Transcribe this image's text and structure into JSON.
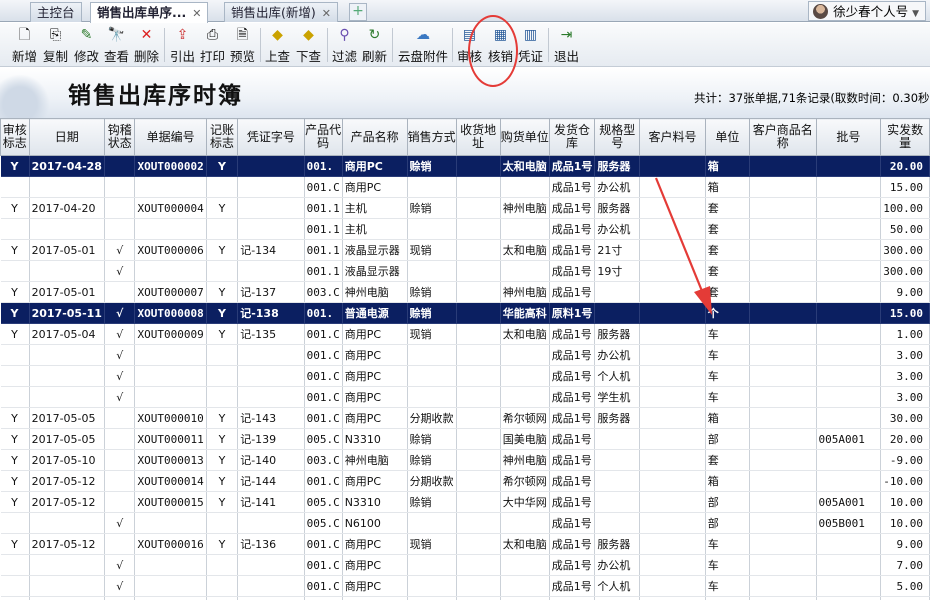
{
  "tabs": [
    {
      "label": "主控台",
      "active": false,
      "closable": false
    },
    {
      "label": "销售出库单序...",
      "active": true,
      "closable": true
    },
    {
      "label": "销售出库(新增)",
      "active": false,
      "closable": true
    }
  ],
  "user": {
    "name": "徐少春个人号"
  },
  "toolbar": {
    "new": "新增",
    "copy": "复制",
    "edit": "修改",
    "view": "查看",
    "delete": "删除",
    "export": "引出",
    "print": "打印",
    "preview": "预览",
    "first": "上查",
    "next": "下查",
    "filter": "过滤",
    "refresh": "刷新",
    "cloud": "云盘附件",
    "audit": "审核",
    "verify": "核销",
    "voucher": "凭证",
    "exit": "退出"
  },
  "page": {
    "title": "销售出库序时簿",
    "summary": "共计：37张单据,71条记录(取数时间：0.30秒)"
  },
  "columns": [
    "审核标志",
    "日期",
    "钩稽状态",
    "单据编号",
    "记账标志",
    "凭证字号",
    "产品代码",
    "产品名称",
    "销售方式",
    "收货地址",
    "购货单位",
    "发货仓库",
    "规格型号",
    "客户料号",
    "单位",
    "客户商品名称",
    "批号",
    "实发数量"
  ],
  "rows": [
    {
      "sel": true,
      "cells": [
        "Y",
        "2017-04-28",
        "",
        "XOUT000002",
        "Y",
        "",
        "001.",
        "商用PC",
        "赊销",
        "",
        "太和电脑",
        "成品1号",
        "服务器",
        "",
        "箱",
        "",
        "",
        "20.00"
      ]
    },
    {
      "sel": false,
      "cells": [
        "",
        "",
        "",
        "",
        "",
        "",
        "001.C",
        "商用PC",
        "",
        "",
        "",
        "成品1号",
        "办公机",
        "",
        "箱",
        "",
        "",
        "15.00"
      ]
    },
    {
      "sel": false,
      "cells": [
        "Y",
        "2017-04-20",
        "",
        "XOUT000004",
        "Y",
        "",
        "001.1",
        "主机",
        "赊销",
        "",
        "神州电脑",
        "成品1号",
        "服务器",
        "",
        "套",
        "",
        "",
        "100.00"
      ]
    },
    {
      "sel": false,
      "cells": [
        "",
        "",
        "",
        "",
        "",
        "",
        "001.1",
        "主机",
        "",
        "",
        "",
        "成品1号",
        "办公机",
        "",
        "套",
        "",
        "",
        "50.00"
      ]
    },
    {
      "sel": false,
      "cells": [
        "Y",
        "2017-05-01",
        "√",
        "XOUT000006",
        "Y",
        "记-134",
        "001.1",
        "液晶显示器",
        "现销",
        "",
        "太和电脑",
        "成品1号",
        "21寸",
        "",
        "套",
        "",
        "",
        "300.00"
      ]
    },
    {
      "sel": false,
      "cells": [
        "",
        "",
        "√",
        "",
        "",
        "",
        "001.1",
        "液晶显示器",
        "",
        "",
        "",
        "成品1号",
        "19寸",
        "",
        "套",
        "",
        "",
        "300.00"
      ]
    },
    {
      "sel": false,
      "cells": [
        "Y",
        "2017-05-01",
        "",
        "XOUT000007",
        "Y",
        "记-137",
        "003.C",
        "神州电脑",
        "赊销",
        "",
        "神州电脑",
        "成品1号",
        "",
        "",
        "套",
        "",
        "",
        "9.00"
      ]
    },
    {
      "sel": true,
      "cells": [
        "Y",
        "2017-05-11",
        "√",
        "XOUT000008",
        "Y",
        "记-138",
        "001.",
        "普通电源",
        "赊销",
        "",
        "华能高科",
        "原料1号",
        "",
        "",
        "个",
        "",
        "",
        "15.00"
      ]
    },
    {
      "sel": false,
      "cells": [
        "Y",
        "2017-05-04",
        "√",
        "XOUT000009",
        "Y",
        "记-135",
        "001.C",
        "商用PC",
        "现销",
        "",
        "太和电脑",
        "成品1号",
        "服务器",
        "",
        "车",
        "",
        "",
        "1.00"
      ]
    },
    {
      "sel": false,
      "cells": [
        "",
        "",
        "√",
        "",
        "",
        "",
        "001.C",
        "商用PC",
        "",
        "",
        "",
        "成品1号",
        "办公机",
        "",
        "车",
        "",
        "",
        "3.00"
      ]
    },
    {
      "sel": false,
      "cells": [
        "",
        "",
        "√",
        "",
        "",
        "",
        "001.C",
        "商用PC",
        "",
        "",
        "",
        "成品1号",
        "个人机",
        "",
        "车",
        "",
        "",
        "3.00"
      ]
    },
    {
      "sel": false,
      "cells": [
        "",
        "",
        "√",
        "",
        "",
        "",
        "001.C",
        "商用PC",
        "",
        "",
        "",
        "成品1号",
        "学生机",
        "",
        "车",
        "",
        "",
        "3.00"
      ]
    },
    {
      "sel": false,
      "cells": [
        "Y",
        "2017-05-05",
        "",
        "XOUT000010",
        "Y",
        "记-143",
        "001.C",
        "商用PC",
        "分期收款",
        "",
        "希尔顿网",
        "成品1号",
        "服务器",
        "",
        "箱",
        "",
        "",
        "30.00"
      ]
    },
    {
      "sel": false,
      "cells": [
        "Y",
        "2017-05-05",
        "",
        "XOUT000011",
        "Y",
        "记-139",
        "005.C",
        "N3310",
        "赊销",
        "",
        "国美电脑",
        "成品1号",
        "",
        "",
        "部",
        "",
        "005A001",
        "20.00"
      ]
    },
    {
      "sel": false,
      "cells": [
        "Y",
        "2017-05-10",
        "",
        "XOUT000013",
        "Y",
        "记-140",
        "003.C",
        "神州电脑",
        "赊销",
        "",
        "神州电脑",
        "成品1号",
        "",
        "",
        "套",
        "",
        "",
        "-9.00"
      ]
    },
    {
      "sel": false,
      "cells": [
        "Y",
        "2017-05-12",
        "",
        "XOUT000014",
        "Y",
        "记-144",
        "001.C",
        "商用PC",
        "分期收款",
        "",
        "希尔顿网",
        "成品1号",
        "",
        "",
        "箱",
        "",
        "",
        "-10.00"
      ]
    },
    {
      "sel": false,
      "cells": [
        "Y",
        "2017-05-12",
        "",
        "XOUT000015",
        "Y",
        "记-141",
        "005.C",
        "N3310",
        "赊销",
        "",
        "大中华网",
        "成品1号",
        "",
        "",
        "部",
        "",
        "005A001",
        "10.00"
      ]
    },
    {
      "sel": false,
      "cells": [
        "",
        "",
        "√",
        "",
        "",
        "",
        "005.C",
        "N6100",
        "",
        "",
        "",
        "成品1号",
        "",
        "",
        "部",
        "",
        "005B001",
        "10.00"
      ]
    },
    {
      "sel": false,
      "cells": [
        "Y",
        "2017-05-12",
        "",
        "XOUT000016",
        "Y",
        "记-136",
        "001.C",
        "商用PC",
        "现销",
        "",
        "太和电脑",
        "成品1号",
        "服务器",
        "",
        "车",
        "",
        "",
        "9.00"
      ]
    },
    {
      "sel": false,
      "cells": [
        "",
        "",
        "√",
        "",
        "",
        "",
        "001.C",
        "商用PC",
        "",
        "",
        "",
        "成品1号",
        "办公机",
        "",
        "车",
        "",
        "",
        "7.00"
      ]
    },
    {
      "sel": false,
      "cells": [
        "",
        "",
        "√",
        "",
        "",
        "",
        "001.C",
        "商用PC",
        "",
        "",
        "",
        "成品1号",
        "个人机",
        "",
        "车",
        "",
        "",
        "5.00"
      ]
    },
    {
      "sel": false,
      "cells": [
        "",
        "",
        "",
        "",
        "",
        "",
        "",
        "",
        "",
        "",
        "",
        "",
        "",
        "",
        "",
        "",
        "",
        ""
      ]
    }
  ],
  "annotation_color": "#e43b37",
  "selection_color": "#0b1f61"
}
